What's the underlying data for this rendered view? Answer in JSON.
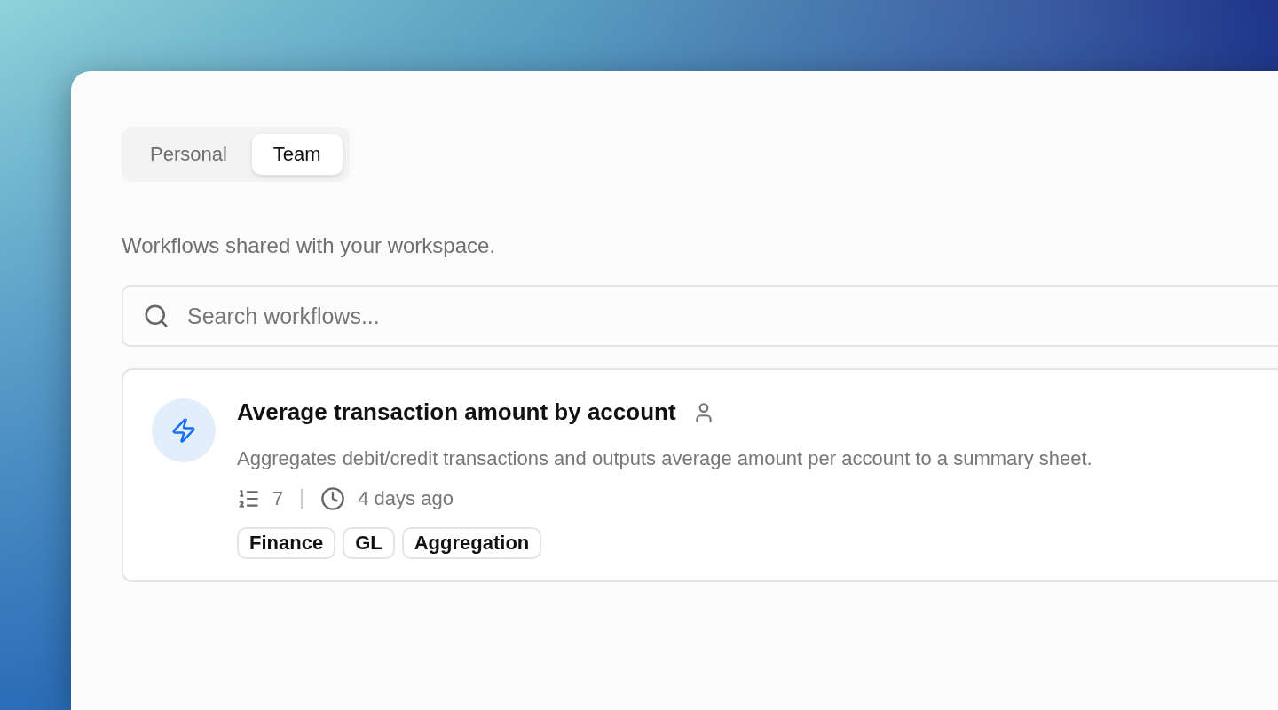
{
  "tabs": [
    {
      "label": "Personal",
      "selected": false
    },
    {
      "label": "Team",
      "selected": true
    }
  ],
  "description": "Workflows shared with your workspace.",
  "search": {
    "placeholder": "Search workflows..."
  },
  "workflows": [
    {
      "title": "Average transaction amount by account",
      "shared_by_person": true,
      "summary": "Aggregates debit/credit transactions and outputs average amount per account to a summary sheet.",
      "steps": "7",
      "updated": "4 days ago",
      "tags": [
        "Finance",
        "GL",
        "Aggregation"
      ]
    }
  ]
}
